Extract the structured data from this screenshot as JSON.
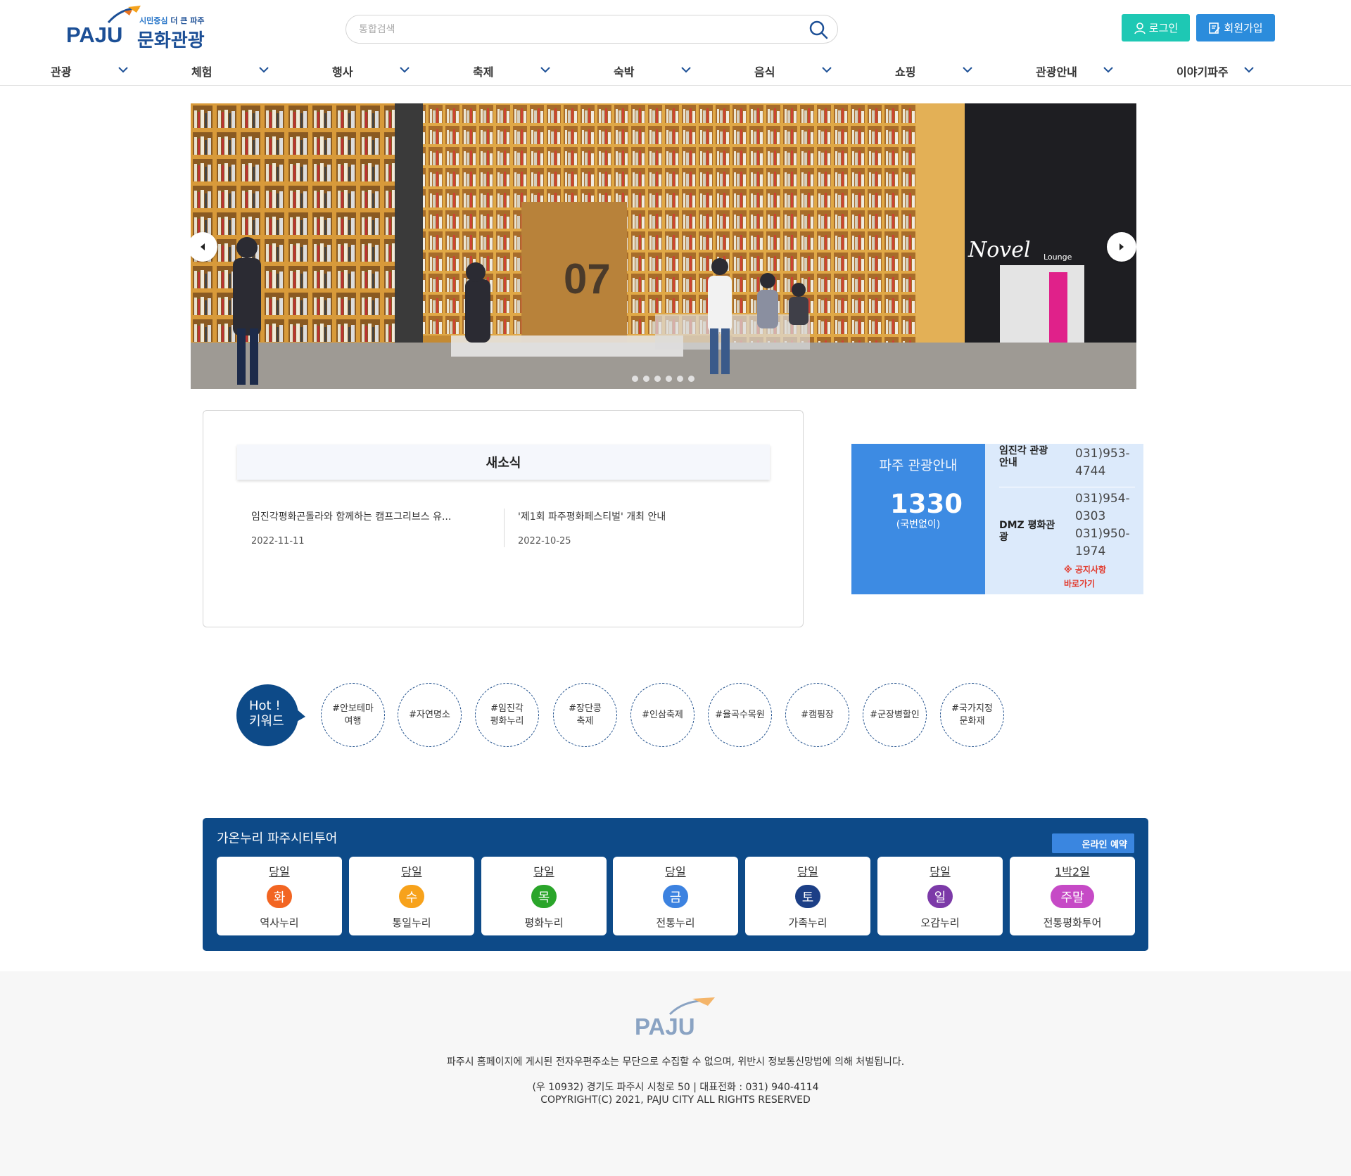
{
  "header": {
    "logo_text": "PAJU",
    "logo_tag_a": "시민중심",
    "logo_tag_b": "더 큰 파주",
    "logo_title": "문화관광",
    "search_placeholder": "통합검색",
    "login_label": "로그인",
    "join_label": "회원가입",
    "colors": {
      "brand": "#1c4f96",
      "login": "#1ec8b4",
      "join": "#2b8cdc"
    }
  },
  "nav": {
    "items": [
      {
        "label": "관광"
      },
      {
        "label": "체험"
      },
      {
        "label": "행사"
      },
      {
        "label": "축제"
      },
      {
        "label": "숙박"
      },
      {
        "label": "음식"
      },
      {
        "label": "쇼핑"
      },
      {
        "label": "관광안내"
      },
      {
        "label": "이야기파주"
      }
    ]
  },
  "hero": {
    "slide_count": 6,
    "prev_icon": "chevron-left-icon",
    "next_icon": "chevron-right-icon",
    "overlay_texts": [
      "07",
      "Novel",
      "Lounge"
    ]
  },
  "news": {
    "heading": "새소식",
    "items": [
      {
        "title": "임진각평화곤돌라와 함께하는 캠프그리브스 유...",
        "date": "2022-11-11"
      },
      {
        "title": "'제1회 파주평화페스티벌' 개최 안내",
        "date": "2022-10-25"
      }
    ]
  },
  "info": {
    "title": "파주 관광안내",
    "number": "1330",
    "number_note": "(국번없이)",
    "rows": [
      {
        "label_line1": "임진각 관광",
        "label_line2": "안내",
        "values": [
          "031)953-",
          "4744"
        ]
      },
      {
        "label_line1": "DMZ 평화관",
        "label_line2": "광",
        "values": [
          "031)954-",
          "0303",
          "031)950-",
          "1974"
        ]
      }
    ],
    "notice_line1": "※ 공지사항",
    "notice_line2": "바로가기"
  },
  "hot": {
    "label_line1": "Hot !",
    "label_line2": "키워드",
    "keywords": [
      {
        "l1": "#안보테마",
        "l2": "여행"
      },
      {
        "l1": "#자연명소",
        "l2": ""
      },
      {
        "l1": "#임진각",
        "l2": "평화누리"
      },
      {
        "l1": "#장단콩",
        "l2": "축제"
      },
      {
        "l1": "#인삼축제",
        "l2": ""
      },
      {
        "l1": "#율곡수목원",
        "l2": ""
      },
      {
        "l1": "#캠핑장",
        "l2": ""
      },
      {
        "l1": "#군장병할인",
        "l2": ""
      },
      {
        "l1": "#국가지정",
        "l2": "문화재"
      }
    ]
  },
  "tour": {
    "title": "가온누리 파주시티투어",
    "reserve_label": "온라인 예약",
    "cards": [
      {
        "when": "당일",
        "day": "화",
        "name": "역사누리",
        "color": "#f26522"
      },
      {
        "when": "당일",
        "day": "수",
        "name": "통일누리",
        "color": "#f7a21b"
      },
      {
        "when": "당일",
        "day": "목",
        "name": "평화누리",
        "color": "#2aa52a"
      },
      {
        "when": "당일",
        "day": "금",
        "name": "전통누리",
        "color": "#3c82e0"
      },
      {
        "when": "당일",
        "day": "토",
        "name": "가족누리",
        "color": "#1c3f86"
      },
      {
        "when": "당일",
        "day": "일",
        "name": "오감누리",
        "color": "#7c3aa8"
      },
      {
        "when": "1박2일",
        "day": "주말",
        "name": "전통평화투어",
        "color": "#c64ac6"
      }
    ]
  },
  "footer": {
    "logo_text": "PAJU",
    "line1": "파주시 홈페이지에 게시된 전자우편주소는 무단으로 수집할 수 없으며, 위반시 정보통신망법에 의해 처벌됩니다.",
    "line2": "(우 10932) 경기도 파주시 시청로 50 | 대표전화 : 031) 940-4114",
    "line3": "COPYRIGHT(C) 2021, PAJU CITY ALL RIGHTS RESERVED"
  }
}
